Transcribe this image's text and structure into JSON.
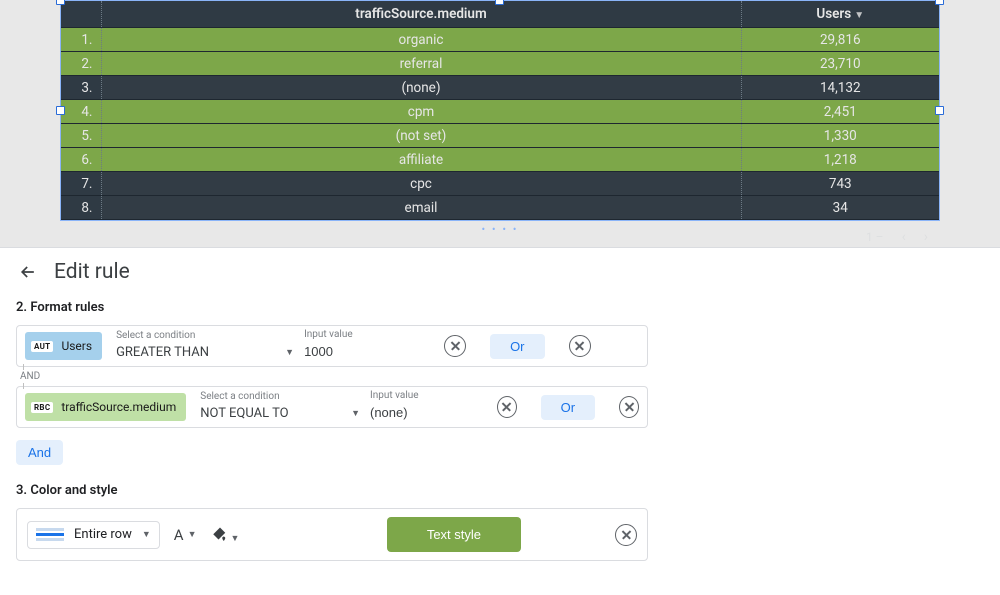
{
  "table": {
    "headers": {
      "medium": "trafficSource.medium",
      "users": "Users"
    },
    "rows": [
      {
        "idx": "1.",
        "medium": "organic",
        "users": "29,816",
        "hl": true
      },
      {
        "idx": "2.",
        "medium": "referral",
        "users": "23,710",
        "hl": true
      },
      {
        "idx": "3.",
        "medium": "(none)",
        "users": "14,132",
        "hl": false
      },
      {
        "idx": "4.",
        "medium": "cpm",
        "users": "2,451",
        "hl": true
      },
      {
        "idx": "5.",
        "medium": "(not set)",
        "users": "1,330",
        "hl": true
      },
      {
        "idx": "6.",
        "medium": "affiliate",
        "users": "1,218",
        "hl": true
      },
      {
        "idx": "7.",
        "medium": "cpc",
        "users": "743",
        "hl": false
      },
      {
        "idx": "8.",
        "medium": "email",
        "users": "34",
        "hl": false
      }
    ]
  },
  "panel": {
    "title": "Edit rule",
    "section2": "2. Format rules",
    "section3": "3. Color and style",
    "cond_label": "Select a condition",
    "val_label": "Input value",
    "and_label": "AND",
    "or_label": "Or",
    "and_btn": "And",
    "rules": [
      {
        "chip_tag": "AUT",
        "chip_text": "Users",
        "chip_style": "blue",
        "condition": "GREATER THAN",
        "value": "1000"
      },
      {
        "chip_tag": "RBC",
        "chip_text": "trafficSource.medium",
        "chip_style": "green",
        "condition": "NOT EQUAL TO",
        "value": "(none)"
      }
    ],
    "style": {
      "target": "Entire row",
      "btn": "Text style"
    }
  }
}
